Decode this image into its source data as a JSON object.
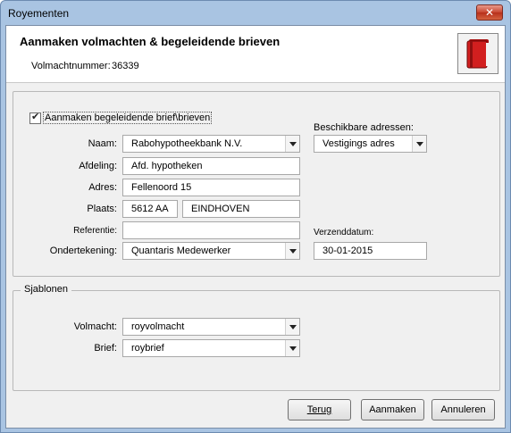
{
  "window": {
    "title": "Royementen",
    "close_glyph": "✕"
  },
  "header": {
    "title": "Aanmaken volmachten & begeleidende brieven",
    "poa_label": "Volmachtnummer:",
    "poa_value": "36339",
    "icon": "red-book-icon"
  },
  "letters": {
    "checkbox_label": "Aanmaken begeleidende brief\\brieven",
    "checked": true,
    "name_label": "Naam:",
    "name_value": "Rabohypotheekbank N.V.",
    "department_label": "Afdeling:",
    "department_value": "Afd. hypotheken",
    "address_label": "Adres:",
    "address_value": "Fellenoord 15",
    "city_label": "Plaats:",
    "postcode_value": "5612 AA",
    "city_value": "EINDHOVEN",
    "reference_label": "Referentie:",
    "reference_value": "",
    "signature_label": "Ondertekening:",
    "signature_value": "Quantaris Medewerker",
    "available_label": "Beschikbare adressen:",
    "available_value": "Vestigings adres",
    "ship_date_label": "Verzenddatum:",
    "ship_date_value": "30-01-2015"
  },
  "templates": {
    "legend": "Sjablonen",
    "poa_label": "Volmacht:",
    "poa_value": "royvolmacht",
    "letter_label": "Brief:",
    "letter_value": "roybrief"
  },
  "buttons": {
    "back": "Terug",
    "create": "Aanmaken",
    "cancel": "Annuleren"
  },
  "colors": {
    "book": "#d21f1f",
    "close": "#c8452f",
    "title_bar": "#a9c4e2"
  }
}
